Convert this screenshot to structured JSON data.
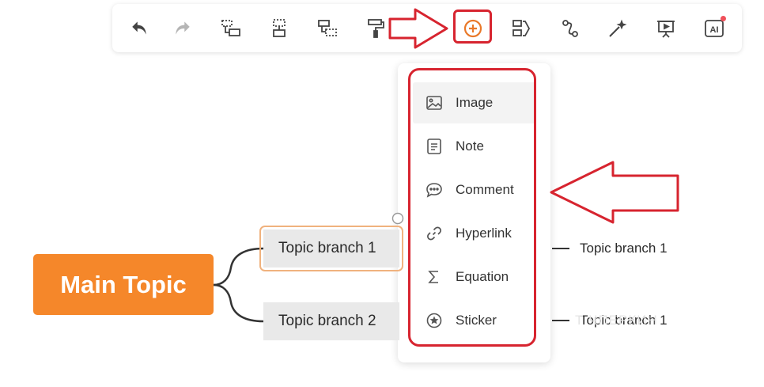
{
  "toolbar": {
    "tools": [
      {
        "name": "undo-icon"
      },
      {
        "name": "redo-icon"
      },
      {
        "name": "subtopic-icon"
      },
      {
        "name": "sibling-topic-icon"
      },
      {
        "name": "floating-topic-icon"
      },
      {
        "name": "format-painter-icon"
      },
      {
        "name": "text-icon"
      },
      {
        "name": "insert-icon"
      },
      {
        "name": "boundary-icon"
      },
      {
        "name": "relationship-icon"
      },
      {
        "name": "magic-wand-icon"
      },
      {
        "name": "presentation-icon"
      },
      {
        "name": "ai-icon"
      }
    ],
    "ai_label": "AI"
  },
  "insert_menu": {
    "items": [
      {
        "label": "Image",
        "icon": "image-icon"
      },
      {
        "label": "Note",
        "icon": "note-icon"
      },
      {
        "label": "Comment",
        "icon": "comment-icon"
      },
      {
        "label": "Hyperlink",
        "icon": "hyperlink-icon"
      },
      {
        "label": "Equation",
        "icon": "equation-icon"
      },
      {
        "label": "Sticker",
        "icon": "sticker-icon"
      }
    ]
  },
  "mindmap": {
    "main_topic": "Main Topic",
    "branches": [
      {
        "label": "Topic branch 1",
        "child": "Topic branch 1"
      },
      {
        "label": "Topic branch 2",
        "child": "Topic branch 1"
      }
    ]
  },
  "watermark": "Т  ЧПЕРКИН",
  "colors": {
    "accent": "#f5872a",
    "highlight": "#d7242f",
    "icon": "#555555"
  }
}
